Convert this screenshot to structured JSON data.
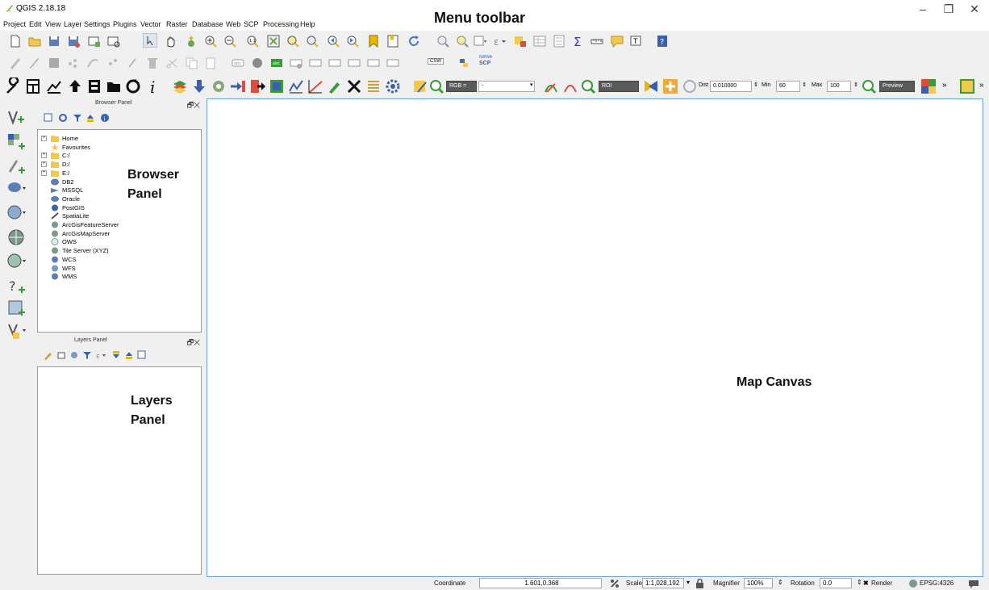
{
  "window": {
    "title": "QGIS 2.18.18",
    "minimize": "–",
    "maximize": "❐",
    "close": "✕"
  },
  "menu": {
    "items": [
      "Project",
      "Edit",
      "View",
      "Layer",
      "Settings",
      "Plugins",
      "Vector",
      "Raster",
      "Database",
      "Web",
      "SCP",
      "Processing",
      "Help"
    ]
  },
  "annotations": {
    "menu_toolbar": "Menu toolbar",
    "browser_panel_1": "Browser",
    "browser_panel_2": "Panel",
    "layers_panel_1": "Layers",
    "layers_panel_2": "Panel",
    "map_canvas": "Map Canvas"
  },
  "scp_toolbar": {
    "rgb_label": "RGB =",
    "rgb_value": "-",
    "roi_label": "ROI",
    "dist_label": "Dist",
    "dist_value": "0.010000",
    "min_label": "Min",
    "min_value": "60",
    "max_label": "Max",
    "max_value": "100",
    "preview_label": "Preview",
    "overflow": "»",
    "csw_label": "CSW",
    "nwwa_label": "NWWA",
    "scp_label": "SCP"
  },
  "browser_panel": {
    "title": "Browser Panel",
    "controls": "🗗✕",
    "items": [
      {
        "label": "Home",
        "expandable": true,
        "icon": "folder-icon"
      },
      {
        "label": "Favourites",
        "expandable": false,
        "icon": "star-icon"
      },
      {
        "label": "C:/",
        "expandable": true,
        "icon": "folder-icon"
      },
      {
        "label": "D:/",
        "expandable": true,
        "icon": "folder-icon"
      },
      {
        "label": "E:/",
        "expandable": true,
        "icon": "folder-icon"
      },
      {
        "label": "DB2",
        "expandable": false,
        "icon": "db2-icon"
      },
      {
        "label": "MSSQL",
        "expandable": false,
        "icon": "mssql-icon"
      },
      {
        "label": "Oracle",
        "expandable": false,
        "icon": "oracle-icon"
      },
      {
        "label": "PostGIS",
        "expandable": false,
        "icon": "postgis-icon"
      },
      {
        "label": "SpatiaLite",
        "expandable": false,
        "icon": "spatialite-icon"
      },
      {
        "label": "ArcGisFeatureServer",
        "expandable": false,
        "icon": "arcgis-feature-icon"
      },
      {
        "label": "ArcGisMapServer",
        "expandable": false,
        "icon": "arcgis-map-icon"
      },
      {
        "label": "OWS",
        "expandable": false,
        "icon": "ows-icon"
      },
      {
        "label": "Tile Server (XYZ)",
        "expandable": false,
        "icon": "xyz-icon"
      },
      {
        "label": "WCS",
        "expandable": false,
        "icon": "wcs-icon"
      },
      {
        "label": "WFS",
        "expandable": false,
        "icon": "wfs-icon"
      },
      {
        "label": "WMS",
        "expandable": false,
        "icon": "wms-icon"
      }
    ]
  },
  "layers_panel": {
    "title": "Layers Panel",
    "controls": "🗗✕"
  },
  "statusbar": {
    "coordinate_label": "Coordinate",
    "coordinate_value": "1.601,0.368",
    "scale_label": "Scale",
    "scale_value": "1:1,028,192",
    "magnifier_label": "Magnifier",
    "magnifier_value": "100%",
    "rotation_label": "Rotation",
    "rotation_value": "0.0",
    "render_label": "Render",
    "crs_label": "EPSG:4326"
  },
  "colors": {
    "canvas_border": "#6aa0d8",
    "accent_green": "#3a9a3a",
    "folder_yellow": "#f2c94c"
  }
}
